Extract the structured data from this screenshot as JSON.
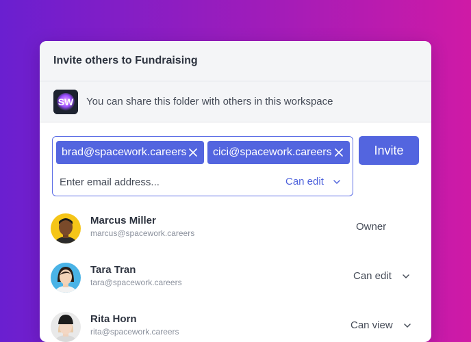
{
  "dialog": {
    "title": "Invite others to Fundraising",
    "share_text": "You can share this folder with others in this workspace",
    "workspace_logo_text": "SW"
  },
  "invite": {
    "chips": [
      "brad@spacework.careers",
      "cici@spacework.careers"
    ],
    "email_placeholder": "Enter email address...",
    "permission": "Can edit",
    "invite_label": "Invite"
  },
  "members": [
    {
      "name": "Marcus Miller",
      "email": "marcus@spacework.careers",
      "role": "Owner"
    },
    {
      "name": "Tara Tran",
      "email": "tara@spacework.careers",
      "role": "Can edit"
    },
    {
      "name": "Rita Horn",
      "email": "rita@spacework.careers",
      "role": "Can view"
    }
  ],
  "colors": {
    "accent": "#5365df",
    "background_start": "#6a1fd0",
    "background_end": "#cf1aa6"
  }
}
